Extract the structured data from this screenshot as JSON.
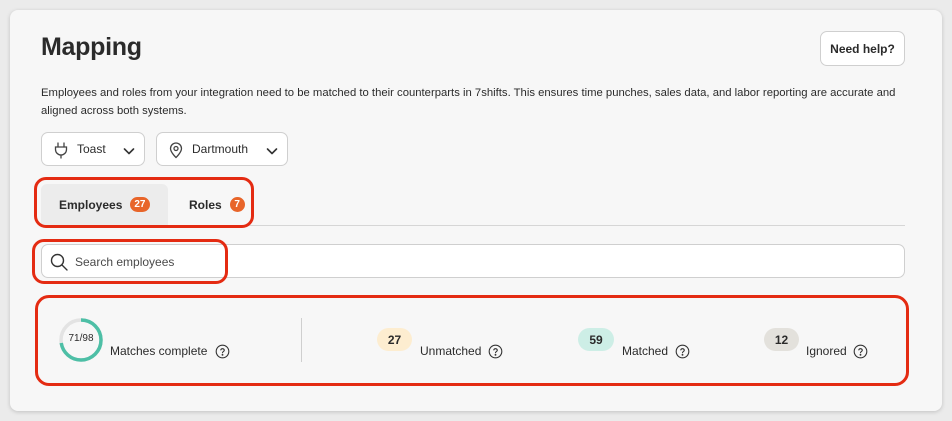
{
  "header": {
    "title": "Mapping",
    "help_label": "Need help?",
    "description": "Employees and roles from your integration need to be matched to their counterparts in 7shifts. This ensures time punches, sales data, and labor reporting are accurate and aligned across both systems."
  },
  "filters": {
    "integration": {
      "value": "Toast",
      "icon": "plug-icon"
    },
    "location": {
      "value": "Dartmouth",
      "icon": "location-pin-icon"
    }
  },
  "tabs": [
    {
      "label": "Employees",
      "count": "27",
      "active": true
    },
    {
      "label": "Roles",
      "count": "7",
      "active": false
    }
  ],
  "search": {
    "placeholder": "Search employees",
    "value": ""
  },
  "stats": {
    "progress": {
      "text": "71/98",
      "label": "Matches complete",
      "matched": 71,
      "total": 98
    },
    "unmatched": {
      "count": "27",
      "label": "Unmatched"
    },
    "matched": {
      "count": "59",
      "label": "Matched"
    },
    "ignored": {
      "count": "12",
      "label": "Ignored"
    }
  },
  "colors": {
    "accent_badge": "#e8652a",
    "highlight_outline": "#e42b12",
    "progress_ring": "#4dbfa6",
    "progress_track": "#e3e3e3",
    "unmatched_pill": "#fdedd0",
    "matched_pill": "#cdeee6",
    "ignored_pill": "#e3e1dc"
  }
}
